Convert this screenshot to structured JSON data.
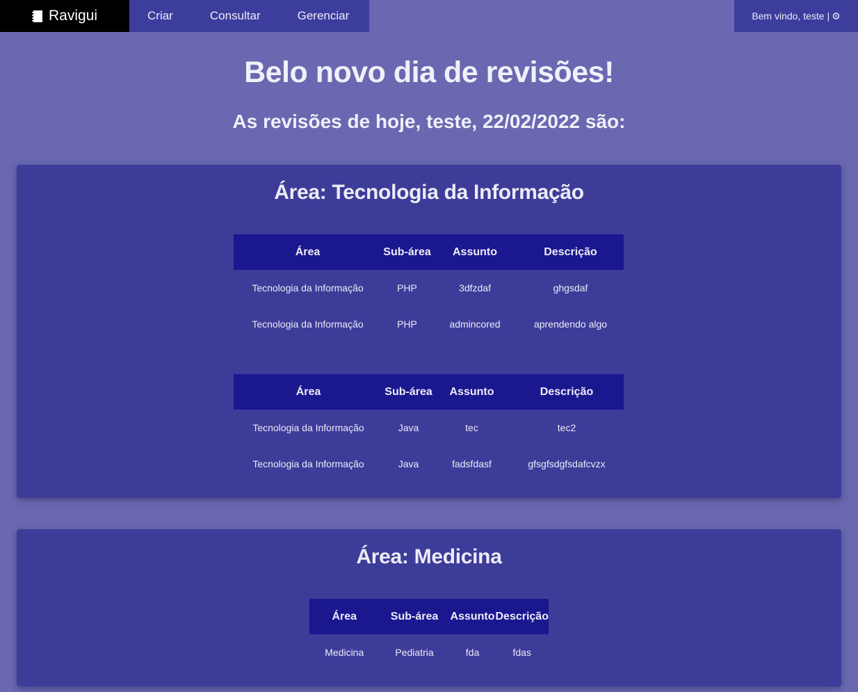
{
  "nav": {
    "brand": "Ravigui",
    "links": [
      "Criar",
      "Consultar",
      "Gerenciar"
    ],
    "welcome": "Bem vindo, teste |"
  },
  "hero": {
    "title": "Belo novo dia de revisões!",
    "subtitle": "As revisões de hoje, teste, 22/02/2022 são:"
  },
  "headers": [
    "Área",
    "Sub-área",
    "Assunto",
    "Descrição"
  ],
  "areas": [
    {
      "title": "Área: Tecnologia da Informação",
      "tables": [
        {
          "rows": [
            [
              "Tecnologia da Informação",
              "PHP",
              "3dfzdaf",
              "ghgsdaf"
            ],
            [
              "Tecnologia da Informação",
              "PHP",
              "admincored",
              "aprendendo algo"
            ]
          ]
        },
        {
          "rows": [
            [
              "Tecnologia da Informação",
              "Java",
              "tec",
              "tec2"
            ],
            [
              "Tecnologia da Informação",
              "Java",
              "fadsfdasf",
              "gfsgfsdgfsdafcvzx"
            ]
          ]
        }
      ]
    },
    {
      "title": "Área: Medicina",
      "tables": [
        {
          "rows": [
            [
              "Medicina",
              "Pediatria",
              "fda",
              "fdas"
            ]
          ]
        }
      ]
    }
  ],
  "colors": {
    "page_bg": "#6a68b0",
    "nav_bg": "#3d3d9e",
    "brand_bg": "#000000",
    "card_bg": "#3d3c99",
    "table_header_bg": "#1a178f",
    "text": "#ececf7"
  },
  "icons": {
    "brand": "notebook-icon",
    "settings": "gear-icon"
  }
}
